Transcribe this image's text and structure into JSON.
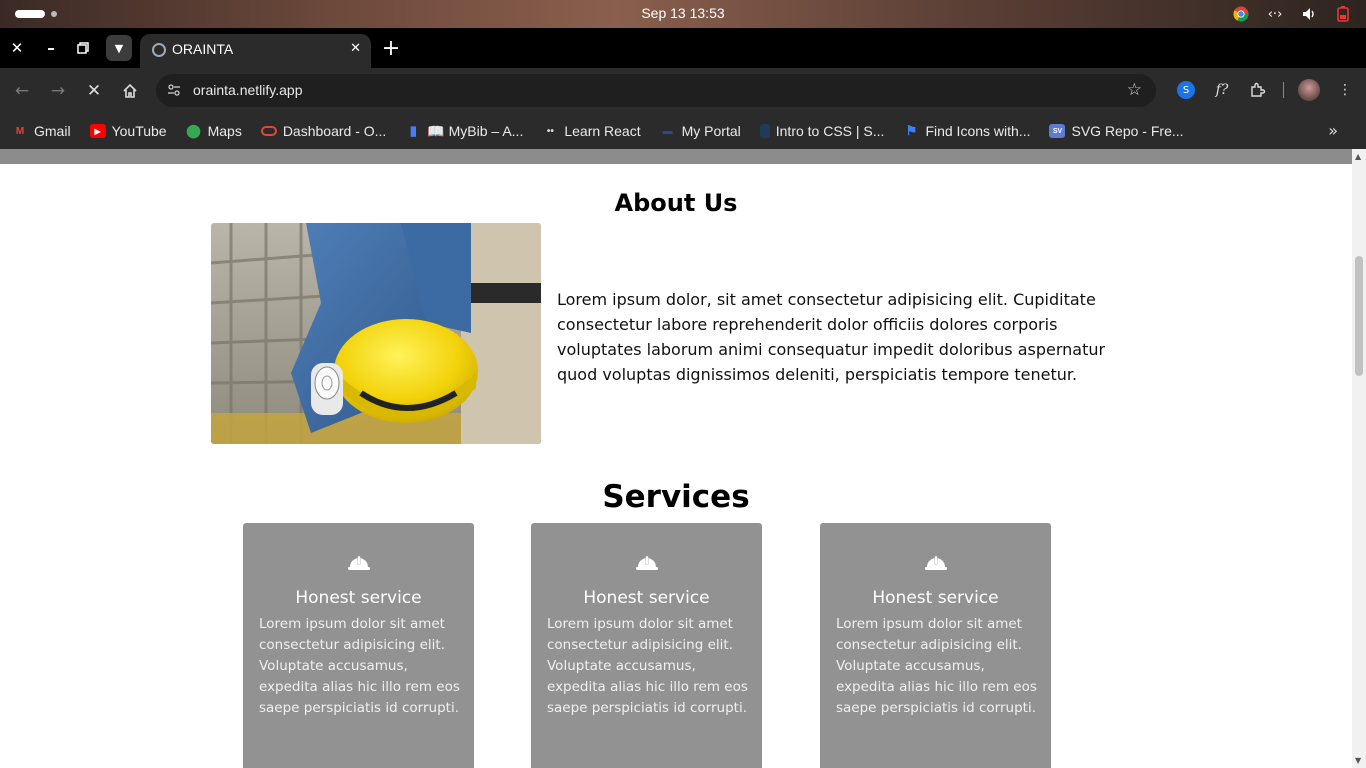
{
  "os": {
    "clock": "Sep 13  13:53"
  },
  "browser": {
    "tab_title": "ORAINTA",
    "url": "orainta.netlify.app"
  },
  "bookmarks": [
    {
      "label": "Gmail",
      "icon": "gmail-icon",
      "color": "#ea4335"
    },
    {
      "label": "YouTube",
      "icon": "youtube-icon",
      "color": "#ff0000"
    },
    {
      "label": "Maps",
      "icon": "maps-icon",
      "color": "#34a853"
    },
    {
      "label": "Dashboard - O...",
      "icon": "oracle-icon",
      "color": "#e0463a"
    },
    {
      "label": "📖 MyBib – A...",
      "icon": "bookmark-icon",
      "color": "#4a7bf7"
    },
    {
      "label": "Learn React",
      "icon": "react-icon",
      "color": "#dddddd"
    },
    {
      "label": "My Portal",
      "icon": "portal-icon",
      "color": "#2b4a8a"
    },
    {
      "label": "Intro to CSS | S...",
      "icon": "css-icon",
      "color": "#1f3a5a"
    },
    {
      "label": "Find Icons with...",
      "icon": "flag-icon",
      "color": "#3b82f6"
    },
    {
      "label": "SVG Repo - Fre...",
      "icon": "svgrepo-icon",
      "color": "#5b7bd5"
    }
  ],
  "about": {
    "title": "About Us",
    "text": "Lorem ipsum dolor, sit amet consectetur adipisicing elit. Cupiditate consectetur labore reprehenderit dolor officiis dolores corporis voluptates laborum animi consequatur impedit doloribus aspernatur quod voluptas dignissimos deleniti, perspiciatis tempore tenetur."
  },
  "services": {
    "title": "Services",
    "cards": [
      {
        "title": "Honest service",
        "text": "Lorem ipsum dolor sit amet consectetur adipisicing elit. Voluptate accusamus, expedita alias hic illo rem eos saepe perspiciatis id corrupti."
      },
      {
        "title": "Honest service",
        "text": "Lorem ipsum dolor sit amet consectetur adipisicing elit. Voluptate accusamus, expedita alias hic illo rem eos saepe perspiciatis id corrupti."
      },
      {
        "title": "Honest service",
        "text": "Lorem ipsum dolor sit amet consectetur adipisicing elit. Voluptate accusamus, expedita alias hic illo rem eos saepe perspiciatis id corrupti."
      }
    ]
  },
  "colors": {
    "card_bg": "#929292",
    "page_topbar": "#8c8c8c",
    "browser_chrome": "#2b2b2b"
  }
}
